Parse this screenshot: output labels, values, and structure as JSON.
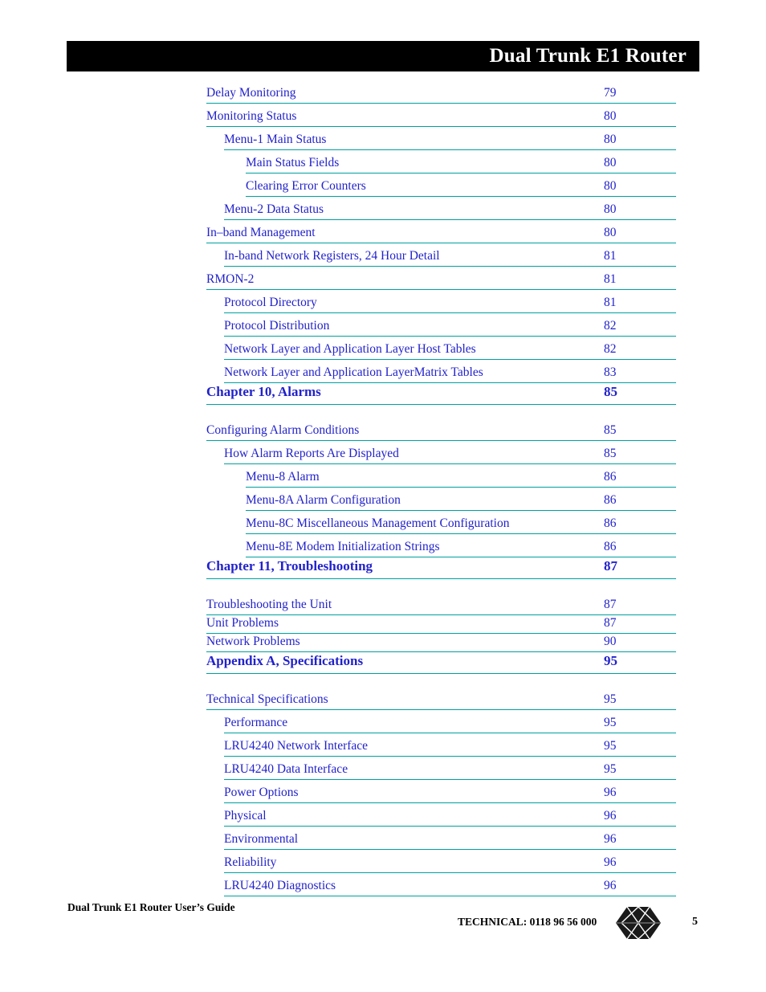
{
  "header": {
    "title": "Dual Trunk E1 Router"
  },
  "toc": {
    "entries": [
      {
        "label": "Delay Monitoring",
        "page": "79",
        "level": 0,
        "chapter": false,
        "gap": "gap-none"
      },
      {
        "label": "Monitoring Status",
        "page": "80",
        "level": 0,
        "chapter": false,
        "gap": "gap-sm"
      },
      {
        "label": "Menu-1 Main Status",
        "page": "80",
        "level": 1,
        "chapter": false,
        "gap": "gap-sm"
      },
      {
        "label": "Main Status Fields",
        "page": "80",
        "level": 2,
        "chapter": false,
        "gap": "gap-sm"
      },
      {
        "label": "Clearing Error Counters",
        "page": "80",
        "level": 2,
        "chapter": false,
        "gap": "gap-sm"
      },
      {
        "label": "Menu-2 Data Status",
        "page": "80",
        "level": 1,
        "chapter": false,
        "gap": "gap-sm"
      },
      {
        "label": "In–band Management",
        "page": "80",
        "level": 0,
        "chapter": false,
        "gap": "gap-sm"
      },
      {
        "label": "In-band Network Registers, 24 Hour Detail",
        "page": "81",
        "level": 1,
        "chapter": false,
        "gap": "gap-sm"
      },
      {
        "label": "RMON-2",
        "page": "81",
        "level": 0,
        "chapter": false,
        "gap": "gap-sm"
      },
      {
        "label": "Protocol Directory",
        "page": "81",
        "level": 1,
        "chapter": false,
        "gap": "gap-sm"
      },
      {
        "label": "Protocol Distribution",
        "page": "82",
        "level": 1,
        "chapter": false,
        "gap": "gap-sm"
      },
      {
        "label": "Network Layer and Application Layer Host Tables",
        "page": "82",
        "level": 1,
        "chapter": false,
        "gap": "gap-sm"
      },
      {
        "label": "Network Layer and Application LayerMatrix Tables",
        "page": "83",
        "level": 1,
        "chapter": false,
        "gap": "gap-sm"
      },
      {
        "label": "Chapter 10, Alarms",
        "page": "85",
        "level": 0,
        "chapter": true,
        "gap": "gap-none"
      },
      {
        "label": "Configuring Alarm Conditions",
        "page": "85",
        "level": 0,
        "chapter": false,
        "gap": "gap-lg"
      },
      {
        "label": "How Alarm Reports Are Displayed",
        "page": "85",
        "level": 1,
        "chapter": false,
        "gap": "gap-sm"
      },
      {
        "label": "Menu-8 Alarm",
        "page": "86",
        "level": 2,
        "chapter": false,
        "gap": "gap-sm"
      },
      {
        "label": "Menu-8A Alarm Configuration",
        "page": "86",
        "level": 2,
        "chapter": false,
        "gap": "gap-sm"
      },
      {
        "label": "Menu-8C Miscellaneous Management Configuration",
        "page": "86",
        "level": 2,
        "chapter": false,
        "gap": "gap-sm"
      },
      {
        "label": "Menu-8E Modem Initialization Strings",
        "page": "86",
        "level": 2,
        "chapter": false,
        "gap": "gap-sm"
      },
      {
        "label": "Chapter 11, Troubleshooting",
        "page": "87",
        "level": 0,
        "chapter": true,
        "gap": "gap-none"
      },
      {
        "label": "Troubleshooting the Unit",
        "page": "87",
        "level": 0,
        "chapter": false,
        "gap": "gap-lg"
      },
      {
        "label": "Unit Problems",
        "page": "87",
        "level": 0,
        "chapter": false,
        "gap": "gap-none"
      },
      {
        "label": "Network Problems",
        "page": "90",
        "level": 0,
        "chapter": false,
        "gap": "gap-none"
      },
      {
        "label": "Appendix A, Specifications",
        "page": "95",
        "level": 0,
        "chapter": true,
        "gap": "gap-none"
      },
      {
        "label": "Technical Specifications",
        "page": "95",
        "level": 0,
        "chapter": false,
        "gap": "gap-lg"
      },
      {
        "label": "Performance",
        "page": "95",
        "level": 1,
        "chapter": false,
        "gap": "gap-sm"
      },
      {
        "label": "LRU4240 Network Interface",
        "page": "95",
        "level": 1,
        "chapter": false,
        "gap": "gap-sm"
      },
      {
        "label": "LRU4240 Data Interface",
        "page": "95",
        "level": 1,
        "chapter": false,
        "gap": "gap-sm"
      },
      {
        "label": "Power Options",
        "page": "96",
        "level": 1,
        "chapter": false,
        "gap": "gap-sm"
      },
      {
        "label": "Physical",
        "page": "96",
        "level": 1,
        "chapter": false,
        "gap": "gap-sm"
      },
      {
        "label": "Environmental",
        "page": "96",
        "level": 1,
        "chapter": false,
        "gap": "gap-sm"
      },
      {
        "label": "Reliability",
        "page": "96",
        "level": 1,
        "chapter": false,
        "gap": "gap-sm"
      },
      {
        "label": "LRU4240 Diagnostics",
        "page": "96",
        "level": 1,
        "chapter": false,
        "gap": "gap-sm"
      }
    ]
  },
  "footer": {
    "guide_title": "Dual Trunk E1 Router User’s Guide",
    "technical": "TECHNICAL:  0118 96 56 000",
    "page_number": "5",
    "logo_name": "hexagon-diamond-logo"
  },
  "colors": {
    "link_blue": "#2222CC",
    "rule_teal": "#00A0A0",
    "header_bar": "#000000",
    "header_text": "#FFFFFF"
  }
}
